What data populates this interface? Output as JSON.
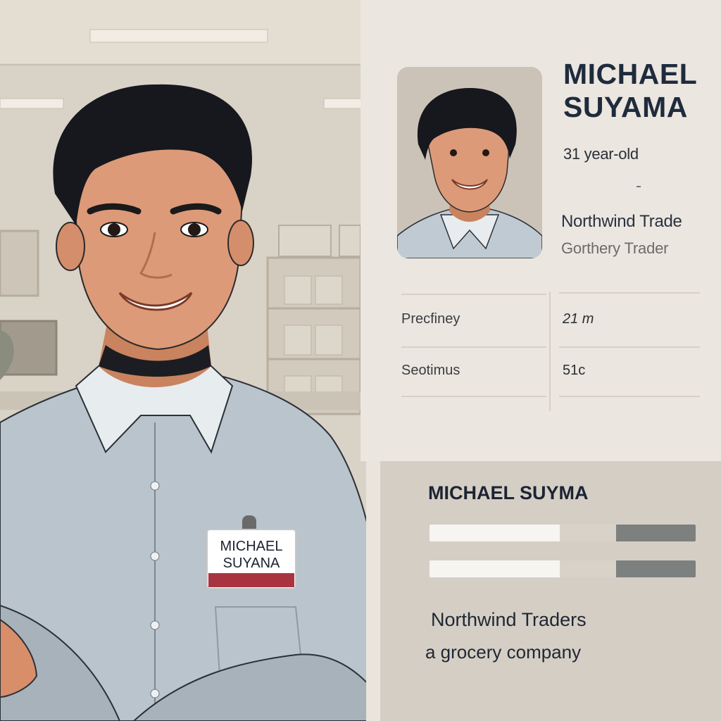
{
  "name_badge": {
    "line1": "MICHAEL",
    "line2": "SUYANA"
  },
  "profile": {
    "name_line1": "MICHAEL",
    "name_line2": "SUYAMA",
    "age": "31 year-old",
    "company": "Northwind Trade",
    "company_sub": "Gorthery Trader"
  },
  "details": [
    {
      "label": "Precfiney",
      "value": "21     m"
    },
    {
      "label": "Seotimus",
      "value": "51c"
    }
  ],
  "summary": {
    "title": "MICHAEL SUYMA",
    "bars": [
      {
        "fill": 0.49,
        "secondary": 0.21
      },
      {
        "fill": 0.49,
        "secondary": 0.21
      }
    ],
    "company": "Northwind Traders",
    "company_description": "a grocery company"
  },
  "colors": {
    "card_bg": "#ebe6df",
    "panel_bg": "#d5cec5",
    "bar_light": "#f7f5f1",
    "bar_mid": "#d9d2c9",
    "bar_dark": "#7c807e",
    "shirt": "#b9c4cc",
    "hair": "#16181d",
    "skin": "#dd9a78",
    "badge_stripe": "#a8343f"
  }
}
